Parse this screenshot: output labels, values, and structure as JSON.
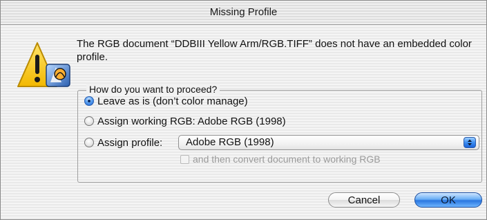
{
  "dialog": {
    "title": "Missing Profile",
    "message": "The RGB document “DDBIII Yellow Arm/RGB.TIFF” does not have an embedded color profile.",
    "group_label": "How do you want to proceed?",
    "options": [
      {
        "label": "Leave as is (don’t color manage)",
        "selected": true
      },
      {
        "label": "Assign working RGB:  Adobe RGB (1998)",
        "selected": false
      },
      {
        "label": "Assign profile:",
        "selected": false
      }
    ],
    "profile_popup_value": "Adobe RGB (1998)",
    "convert_checkbox_label": "and then convert document to working RGB",
    "convert_checkbox_checked": false,
    "convert_checkbox_enabled": false,
    "cancel_label": "Cancel",
    "ok_label": "OK",
    "icon": "warning-icon"
  },
  "colors": {
    "accent": "#2a77e0",
    "warning_yellow": "#f5c400",
    "disabled_text": "#9a9a9a"
  }
}
